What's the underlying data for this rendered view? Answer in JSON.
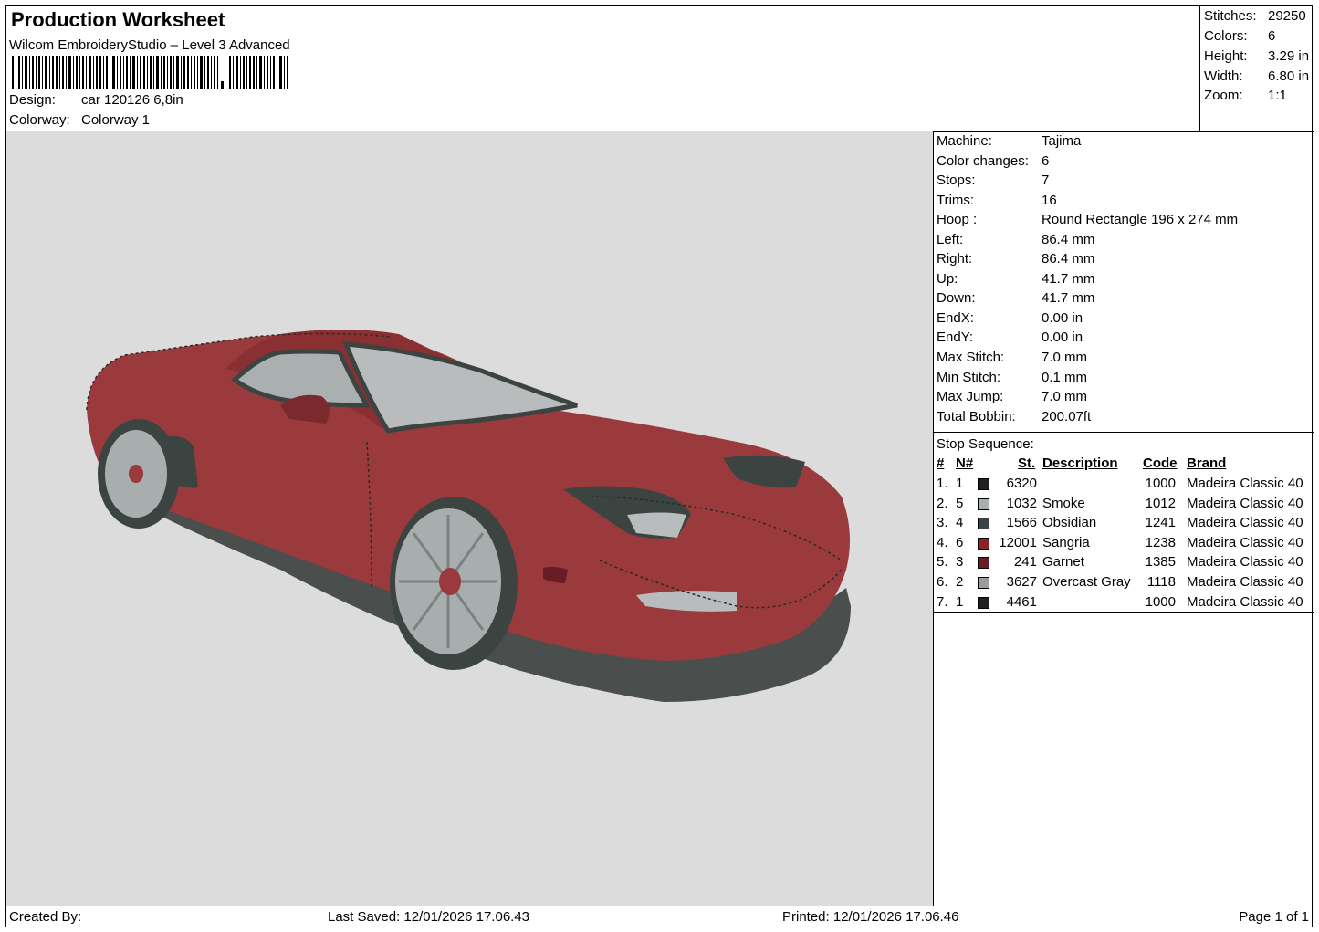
{
  "header": {
    "title": "Production Worksheet",
    "software": "Wilcom EmbroideryStudio – Level 3 Advanced",
    "design_label": "Design:",
    "design_value": "car 120126 6,8in",
    "colorway_label": "Colorway:",
    "colorway_value": "Colorway 1"
  },
  "summary": {
    "stitches_label": "Stitches:",
    "stitches_value": "29250",
    "colors_label": "Colors:",
    "colors_value": "6",
    "height_label": "Height:",
    "height_value": "3.29 in",
    "width_label": "Width:",
    "width_value": "6.80 in",
    "zoom_label": "Zoom:",
    "zoom_value": "1:1"
  },
  "info": [
    {
      "label": "Machine:",
      "value": "Tajima"
    },
    {
      "label": "Color changes:",
      "value": "6"
    },
    {
      "label": "Stops:",
      "value": "7"
    },
    {
      "label": "Trims:",
      "value": "16"
    },
    {
      "label": "Hoop :",
      "value": "Round Rectangle 196 x 274 mm"
    },
    {
      "label": "Left:",
      "value": "86.4 mm"
    },
    {
      "label": "Right:",
      "value": "86.4 mm"
    },
    {
      "label": "Up:",
      "value": "41.7 mm"
    },
    {
      "label": "Down:",
      "value": "41.7 mm"
    },
    {
      "label": "EndX:",
      "value": "0.00 in"
    },
    {
      "label": "EndY:",
      "value": "0.00 in"
    },
    {
      "label": "Max Stitch:",
      "value": "7.0 mm"
    },
    {
      "label": "Min Stitch:",
      "value": "0.1 mm"
    },
    {
      "label": "Max Jump:",
      "value": "7.0 mm"
    },
    {
      "label": "Total Bobbin:",
      "value": "200.07ft"
    }
  ],
  "stop_sequence": {
    "title": "Stop Sequence:",
    "headers": {
      "num": "#",
      "needle": "N#",
      "stitches": "St.",
      "description": "Description",
      "code": "Code",
      "brand": "Brand"
    },
    "rows": [
      {
        "num": "1.",
        "needle": "1",
        "color": "#202020",
        "stitches": "6320",
        "description": "",
        "code": "1000",
        "brand": "Madeira Classic 40"
      },
      {
        "num": "2.",
        "needle": "5",
        "color": "#a8b0b0",
        "stitches": "1032",
        "description": "Smoke",
        "code": "1012",
        "brand": "Madeira Classic 40"
      },
      {
        "num": "3.",
        "needle": "4",
        "color": "#3a4448",
        "stitches": "1566",
        "description": "Obsidian",
        "code": "1241",
        "brand": "Madeira Classic 40"
      },
      {
        "num": "4.",
        "needle": "6",
        "color": "#8c2228",
        "stitches": "12001",
        "description": "Sangria",
        "code": "1238",
        "brand": "Madeira Classic 40"
      },
      {
        "num": "5.",
        "needle": "3",
        "color": "#6a1c24",
        "stitches": "241",
        "description": "Garnet",
        "code": "1385",
        "brand": "Madeira Classic 40"
      },
      {
        "num": "6.",
        "needle": "2",
        "color": "#9a9c9c",
        "stitches": "3627",
        "description": "Overcast Gray",
        "code": "1118",
        "brand": "Madeira Classic 40"
      },
      {
        "num": "7.",
        "needle": "1",
        "color": "#202020",
        "stitches": "4461",
        "description": "",
        "code": "1000",
        "brand": "Madeira Classic 40"
      }
    ]
  },
  "footer": {
    "created_by": "Created By:",
    "last_saved": "Last Saved: 12/01/2026 17.06.43",
    "printed": "Printed: 12/01/2026 17.06.46",
    "page": "Page 1 of 1"
  },
  "colors": {
    "preview_bg": "#dcdcdc",
    "car_body": "#9a3a3c",
    "car_dark": "#3c4442",
    "glass": "#b8bcbc"
  }
}
